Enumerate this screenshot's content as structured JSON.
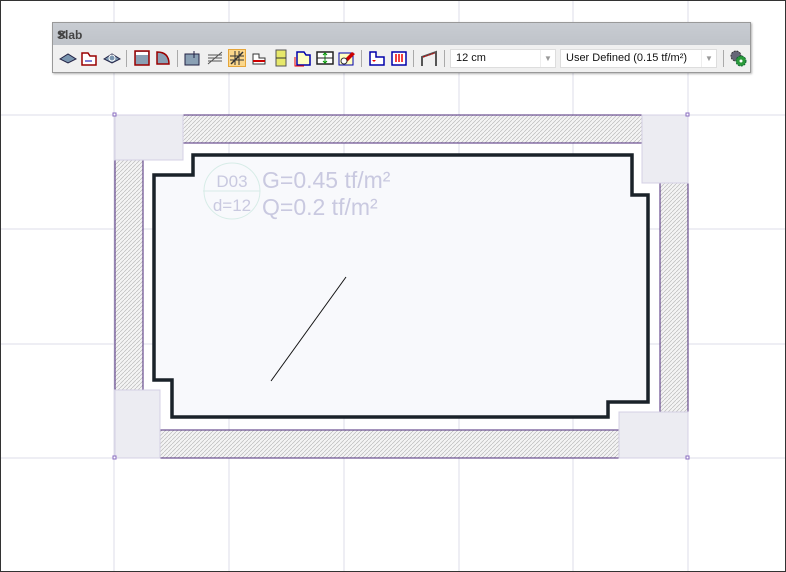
{
  "toolbar": {
    "title": "Slab",
    "close": "✕",
    "thickness": "12 cm",
    "load": "User Defined  (0.15 tf/m²)",
    "icons": [
      "slab-draw-icon",
      "slab-polygon-icon",
      "slab-auto-icon",
      "slab-rect-icon",
      "slab-arc-icon",
      "slab-dimension-icon",
      "slab-hatch-icon",
      "slab-grid-icon",
      "slab-step-icon",
      "slab-beam-icon",
      "slab-region-icon",
      "slab-span-icon",
      "slab-erase-icon",
      "slab-opening-icon",
      "slab-load-icon",
      "slab-ramp-icon"
    ],
    "active_icon": "slab-grid-icon"
  },
  "slab": {
    "name": "D03",
    "thickness": "d=12",
    "dead_load": "G=0.45 tf/m²",
    "live_load": "Q=0.2 tf/m²"
  },
  "colors": {
    "slab_outline": "#1a2229",
    "wall_border": "#4b2a7a",
    "label": "#c9c9e0",
    "grid": "#d8d8e8"
  }
}
